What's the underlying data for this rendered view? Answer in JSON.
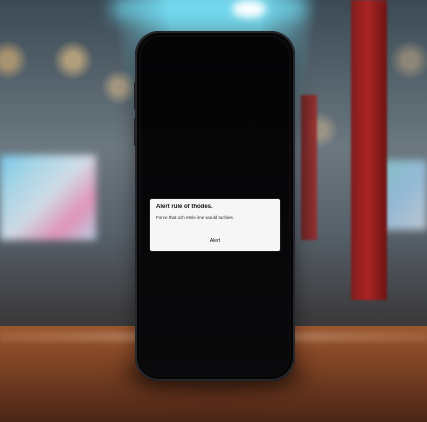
{
  "alert": {
    "title": "Alert rule of thodes.",
    "message": "Force that och etnle ime would tuchies.",
    "action_label": "Alert"
  }
}
